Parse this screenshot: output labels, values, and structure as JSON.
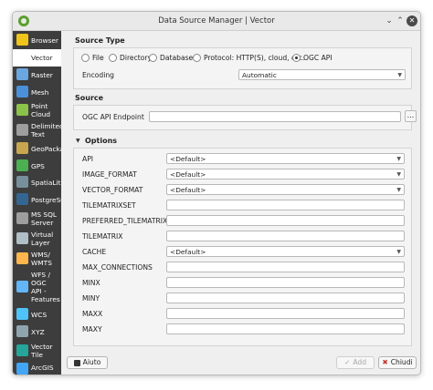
{
  "window": {
    "title": "Data Source Manager | Vector"
  },
  "sidebar": {
    "items": [
      {
        "label_lines": [
          "Browser"
        ]
      },
      {
        "label_lines": [
          "Vector"
        ]
      },
      {
        "label_lines": [
          "Raster"
        ]
      },
      {
        "label_lines": [
          "Mesh"
        ]
      },
      {
        "label_lines": [
          "Point",
          "Cloud"
        ]
      },
      {
        "label_lines": [
          "Delimited",
          "Text"
        ]
      },
      {
        "label_lines": [
          "GeoPackage"
        ]
      },
      {
        "label_lines": [
          "GPS"
        ]
      },
      {
        "label_lines": [
          "SpatiaLite"
        ]
      },
      {
        "label_lines": [
          "PostgreSQL"
        ]
      },
      {
        "label_lines": [
          "MS SQL",
          "Server"
        ]
      },
      {
        "label_lines": [
          "Virtual",
          "Layer"
        ]
      },
      {
        "label_lines": [
          "WMS/",
          "WMTS"
        ]
      },
      {
        "label_lines": [
          "WFS /",
          "OGC",
          "API -",
          "Features"
        ]
      },
      {
        "label_lines": [
          "WCS"
        ]
      },
      {
        "label_lines": [
          "XYZ"
        ]
      },
      {
        "label_lines": [
          "Vector",
          "Tile"
        ]
      },
      {
        "label_lines": [
          "ArcGIS"
        ]
      }
    ]
  },
  "source_type": {
    "title": "Source Type",
    "options": [
      "File",
      "Directory",
      "Database",
      "Protocol: HTTP(S), cloud, etc.",
      "OGC API"
    ],
    "selected": "OGC API",
    "encoding_label": "Encoding",
    "encoding_value": "Automatic"
  },
  "source": {
    "title": "Source",
    "endpoint_label": "OGC API Endpoint",
    "endpoint_value": "",
    "browse_label": "..."
  },
  "options": {
    "title": "Options",
    "rows": [
      {
        "label": "API",
        "value": "<Default>",
        "kind": "select"
      },
      {
        "label": "IMAGE_FORMAT",
        "value": "<Default>",
        "kind": "select"
      },
      {
        "label": "VECTOR_FORMAT",
        "value": "<Default>",
        "kind": "select"
      },
      {
        "label": "TILEMATRIXSET",
        "value": "",
        "kind": "input"
      },
      {
        "label": "PREFERRED_TILEMATRIXSET",
        "value": "",
        "kind": "input"
      },
      {
        "label": "TILEMATRIX",
        "value": "",
        "kind": "input"
      },
      {
        "label": "CACHE",
        "value": "<Default>",
        "kind": "select"
      },
      {
        "label": "MAX_CONNECTIONS",
        "value": "",
        "kind": "input"
      },
      {
        "label": "MINX",
        "value": "",
        "kind": "input"
      },
      {
        "label": "MINY",
        "value": "",
        "kind": "input"
      },
      {
        "label": "MAXX",
        "value": "",
        "kind": "input"
      },
      {
        "label": "MAXY",
        "value": "",
        "kind": "input"
      }
    ]
  },
  "footer": {
    "help_label": "Aiuto",
    "add_label": "Add",
    "close_label": "Chiudi"
  }
}
